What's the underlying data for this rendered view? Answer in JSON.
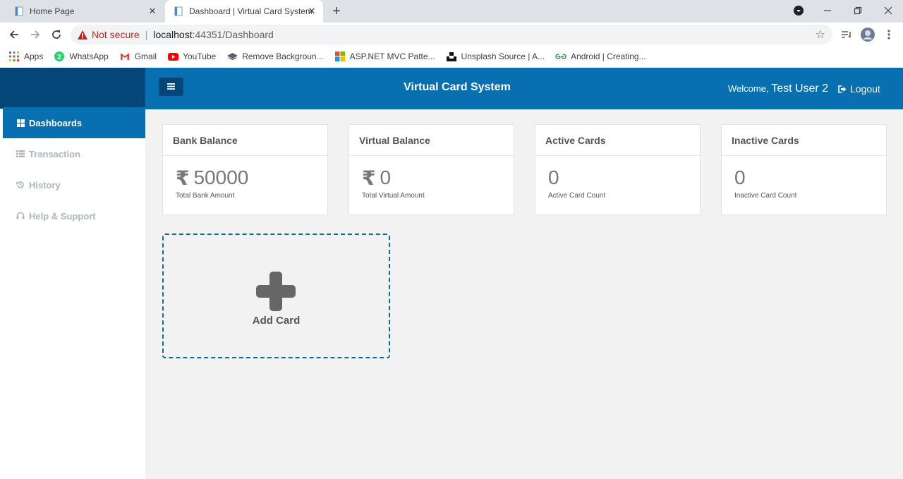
{
  "browser": {
    "tabs": [
      {
        "title": "Home Page"
      },
      {
        "title": "Dashboard | Virtual Card System"
      }
    ],
    "address": {
      "security_warning": "Not secure",
      "host": "localhost",
      "path": ":44351/Dashboard"
    },
    "bookmarks": [
      {
        "label": "Apps",
        "icon": "apps-grid-icon"
      },
      {
        "label": "WhatsApp",
        "icon": "whatsapp-icon"
      },
      {
        "label": "Gmail",
        "icon": "gmail-icon"
      },
      {
        "label": "YouTube",
        "icon": "youtube-icon"
      },
      {
        "label": "Remove Backgroun...",
        "icon": "remove-bg-icon"
      },
      {
        "label": "ASP.NET MVC Patte...",
        "icon": "microsoft-icon"
      },
      {
        "label": "Unsplash Source | A...",
        "icon": "unsplash-icon"
      },
      {
        "label": "Android | Creating...",
        "icon": "geeksforgeeks-icon"
      }
    ]
  },
  "app": {
    "title": "Virtual Card System",
    "welcome_prefix": "Welcome,",
    "user_name": "Test User 2",
    "logout_label": "Logout",
    "colors": {
      "primary": "#0870b0",
      "primary_dark": "#044677",
      "accent_dashed": "#0a6aaa"
    }
  },
  "sidebar": {
    "items": [
      {
        "label": "Dashboards",
        "icon": "grid-icon",
        "active": true
      },
      {
        "label": "Transaction",
        "icon": "list-icon",
        "active": false
      },
      {
        "label": "History",
        "icon": "history-icon",
        "active": false
      },
      {
        "label": "Help & Support",
        "icon": "headset-icon",
        "active": false
      }
    ]
  },
  "cards": [
    {
      "title": "Bank Balance",
      "currency": "₹",
      "value": "50000",
      "subtitle": "Total Bank Amount"
    },
    {
      "title": "Virtual Balance",
      "currency": "₹",
      "value": "0",
      "subtitle": "Total Virtual Amount"
    },
    {
      "title": "Active Cards",
      "currency": "",
      "value": "0",
      "subtitle": "Active Card Count"
    },
    {
      "title": "Inactive Cards",
      "currency": "",
      "value": "0",
      "subtitle": "Inactive Card Count"
    }
  ],
  "add_card": {
    "label": "Add Card"
  }
}
